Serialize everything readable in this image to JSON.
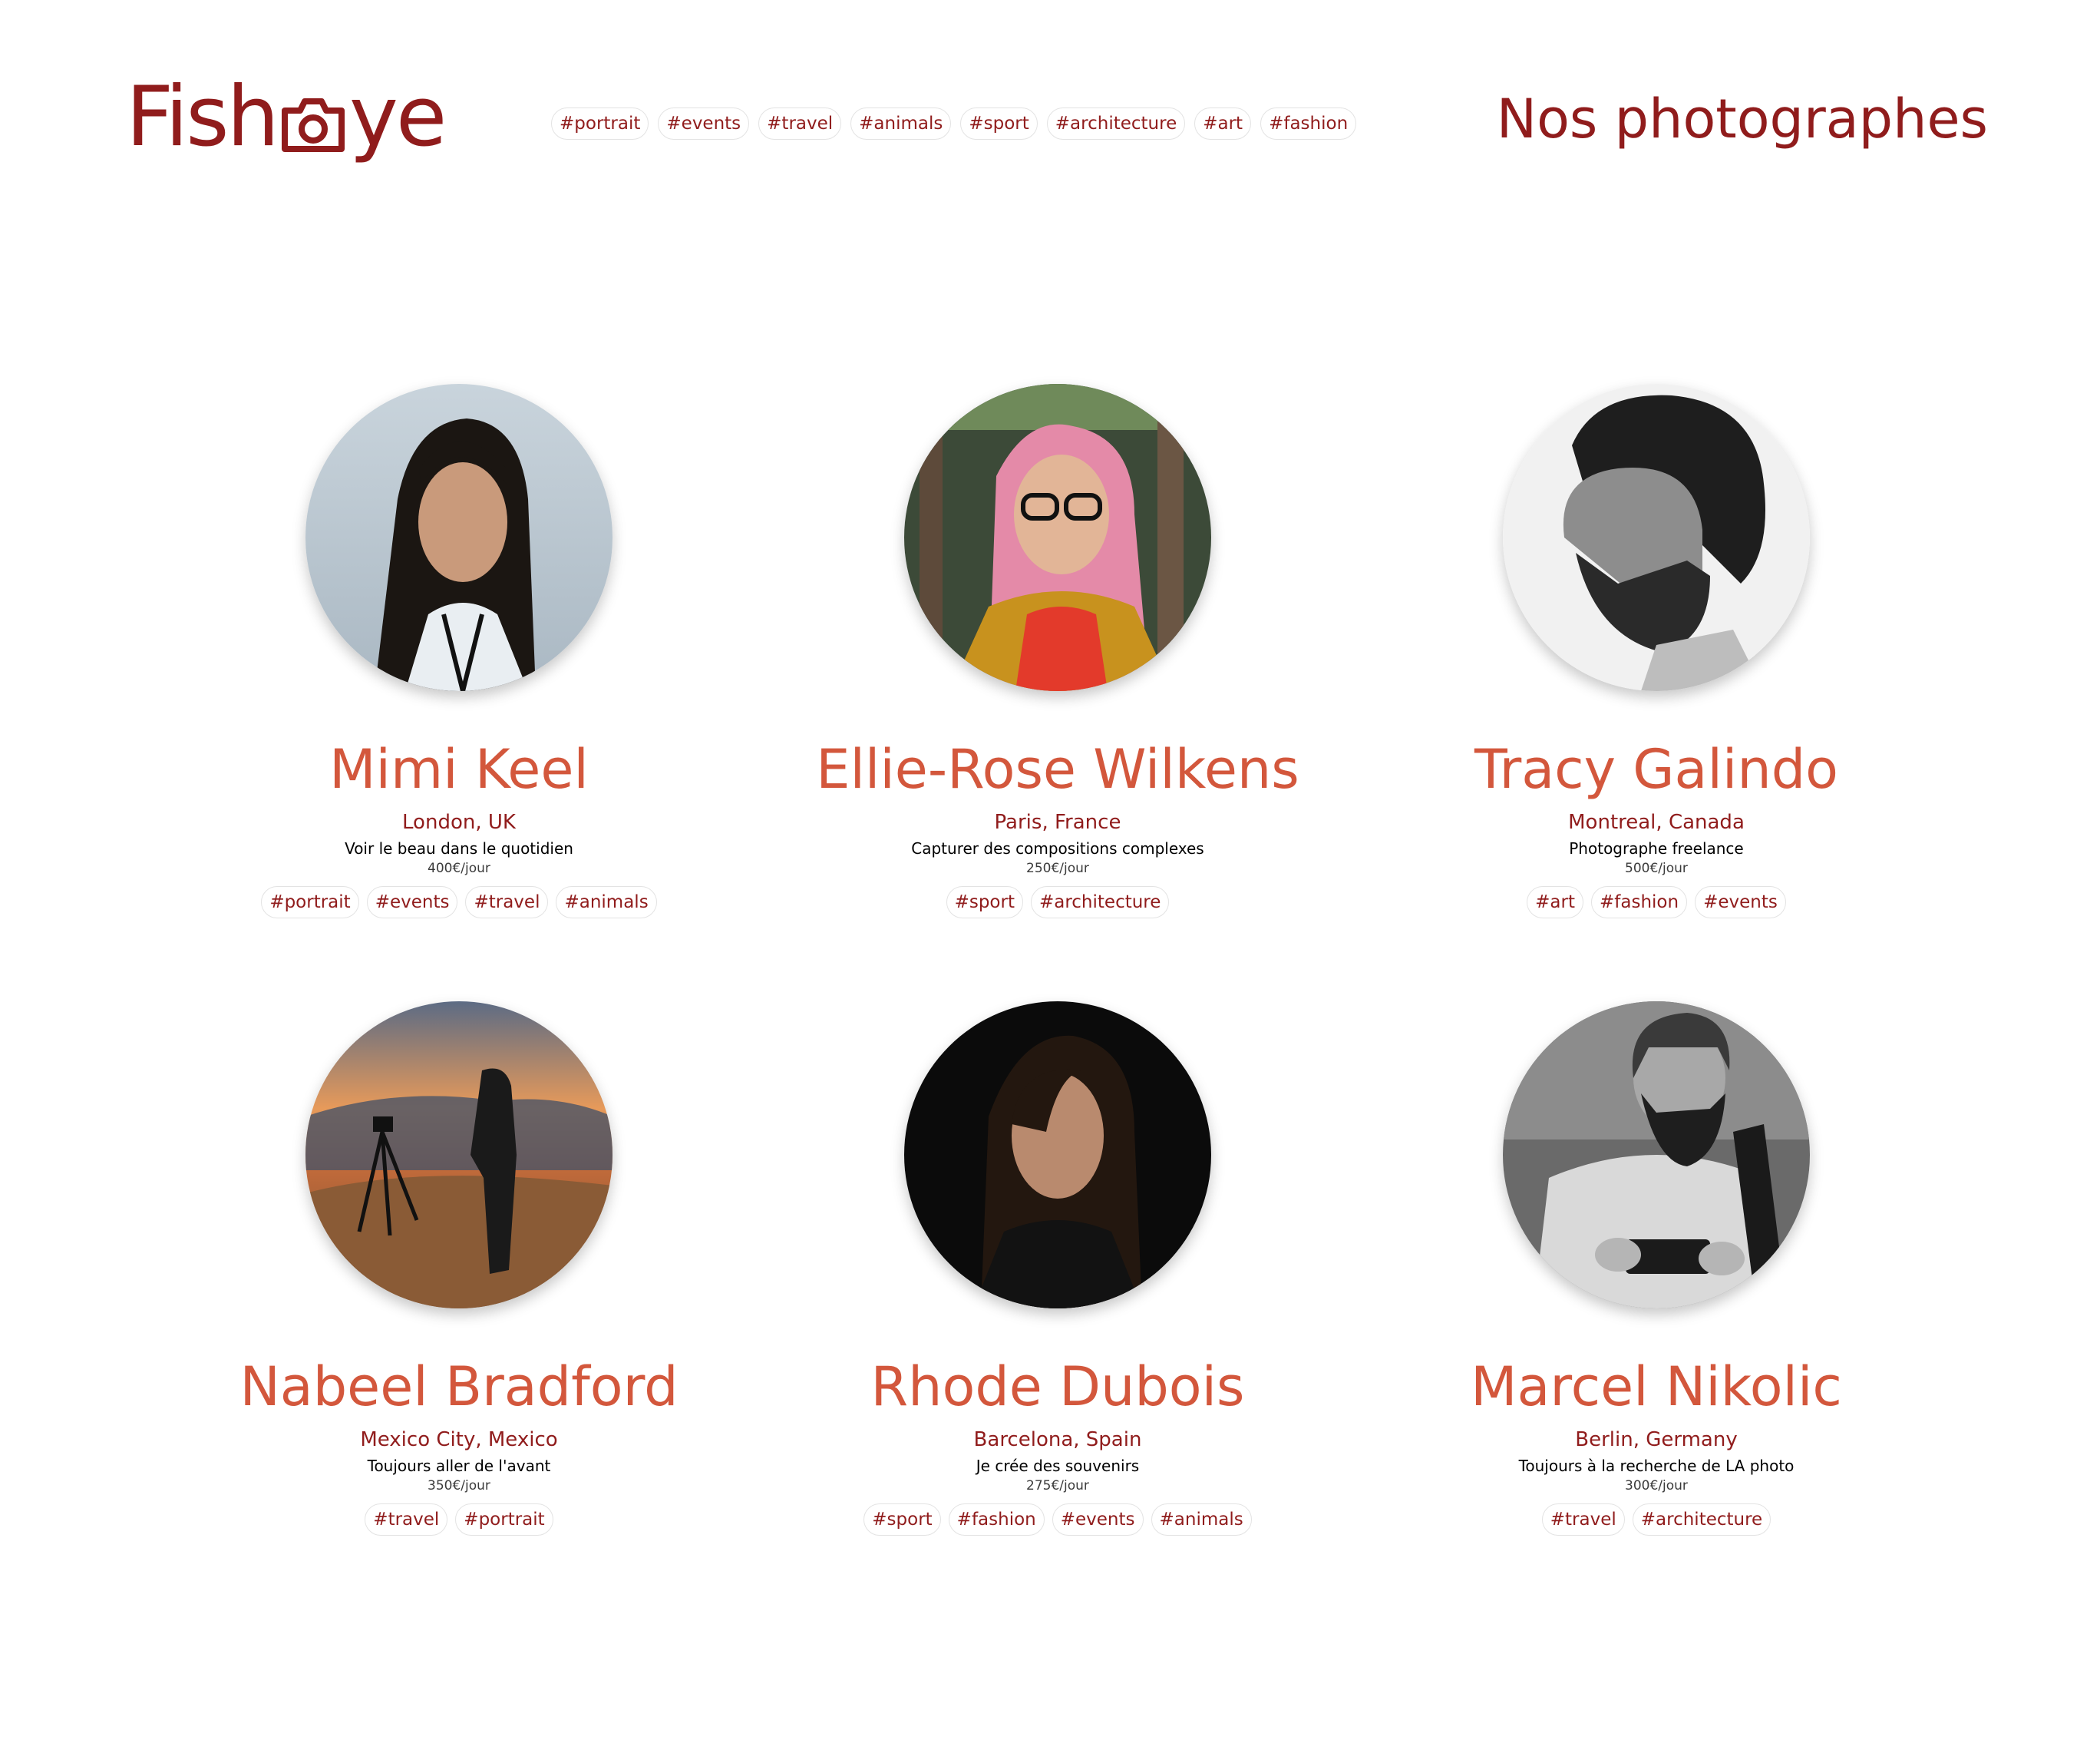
{
  "header": {
    "logo_left": "Fish",
    "logo_right": "ye",
    "logo_icon": "camera-icon",
    "nav_tags": [
      "#portrait",
      "#events",
      "#travel",
      "#animals",
      "#sport",
      "#architecture",
      "#art",
      "#fashion"
    ],
    "title": "Nos photographes"
  },
  "colors": {
    "primary": "#901c1c",
    "accent": "#d3573c",
    "tag_border": "#e3e3e3"
  },
  "photographers": [
    {
      "name": "Mimi Keel",
      "location": "London, UK",
      "tagline": "Voir le beau dans le quotidien",
      "price": "400€/jour",
      "tags": [
        "#portrait",
        "#events",
        "#travel",
        "#animals"
      ]
    },
    {
      "name": "Ellie-Rose Wilkens",
      "location": "Paris, France",
      "tagline": "Capturer des compositions complexes",
      "price": "250€/jour",
      "tags": [
        "#sport",
        "#architecture"
      ]
    },
    {
      "name": "Tracy Galindo",
      "location": "Montreal, Canada",
      "tagline": "Photographe freelance",
      "price": "500€/jour",
      "tags": [
        "#art",
        "#fashion",
        "#events"
      ]
    },
    {
      "name": "Nabeel Bradford",
      "location": "Mexico City, Mexico",
      "tagline": "Toujours aller de l'avant",
      "price": "350€/jour",
      "tags": [
        "#travel",
        "#portrait"
      ]
    },
    {
      "name": "Rhode Dubois",
      "location": "Barcelona, Spain",
      "tagline": "Je crée des souvenirs",
      "price": "275€/jour",
      "tags": [
        "#sport",
        "#fashion",
        "#events",
        "#animals"
      ]
    },
    {
      "name": "Marcel Nikolic",
      "location": "Berlin, Germany",
      "tagline": "Toujours à la recherche de LA photo",
      "price": "300€/jour",
      "tags": [
        "#travel",
        "#architecture"
      ]
    }
  ]
}
